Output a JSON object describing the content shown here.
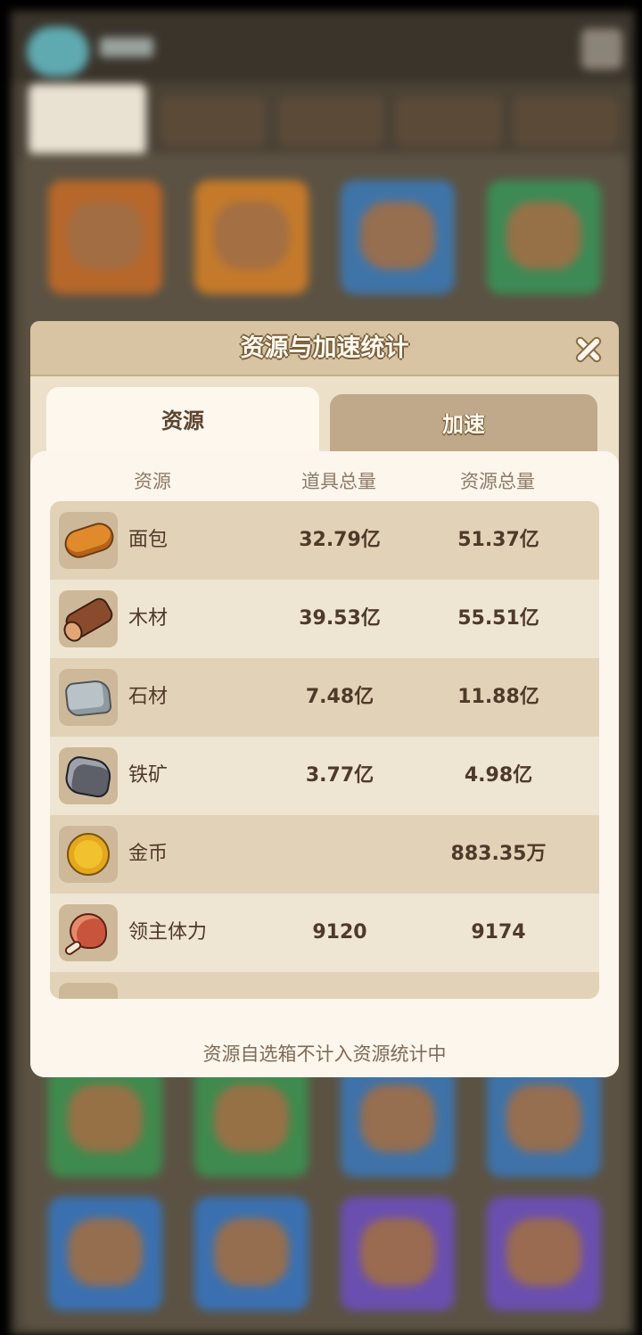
{
  "modal": {
    "title": "资源与加速统计",
    "tabs": {
      "resources": "资源",
      "boost": "加速"
    },
    "active_tab": "resources",
    "columns": {
      "name": "资源",
      "item_total": "道具总量",
      "resource_total": "资源总量"
    },
    "rows": [
      {
        "icon": "bread-icon",
        "name": "面包",
        "item_total": "32.79亿",
        "resource_total": "51.37亿"
      },
      {
        "icon": "wood-icon",
        "name": "木材",
        "item_total": "39.53亿",
        "resource_total": "55.51亿"
      },
      {
        "icon": "stone-icon",
        "name": "石材",
        "item_total": "7.48亿",
        "resource_total": "11.88亿"
      },
      {
        "icon": "iron-ore-icon",
        "name": "铁矿",
        "item_total": "3.77亿",
        "resource_total": "4.98亿"
      },
      {
        "icon": "gold-coin-icon",
        "name": "金币",
        "item_total": "",
        "resource_total": "883.35万"
      },
      {
        "icon": "meat-icon",
        "name": "领主体力",
        "item_total": "9120",
        "resource_total": "9174"
      }
    ],
    "footer_note": "资源自选箱不计入资源统计中"
  },
  "colors": {
    "header_bg": "#d8c4a2",
    "panel_bg": "#fcf6ec",
    "row_dark": "#e2d3b8",
    "row_light": "#efe5d3",
    "text_primary": "#4e3a29"
  }
}
